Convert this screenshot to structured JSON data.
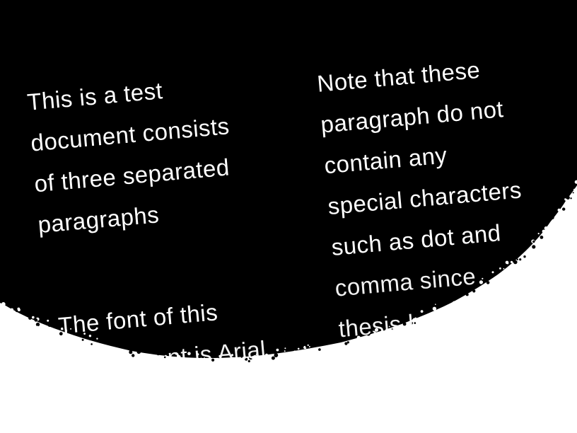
{
  "paragraphs": {
    "left": {
      "lines": [
        "This is a test",
        "document consists",
        "of three separated",
        "paragraphs"
      ]
    },
    "right": {
      "lines": [
        "Note that these",
        "paragraph do not",
        "contain any",
        "special characters",
        "such as dot and",
        "comma since",
        "thesis h"
      ]
    },
    "bottom": {
      "lines": [
        "The font of this",
        "nt is Arial"
      ]
    }
  },
  "colors": {
    "ink_field": "#000000",
    "paper": "#ffffff",
    "text": "#ffffff"
  }
}
